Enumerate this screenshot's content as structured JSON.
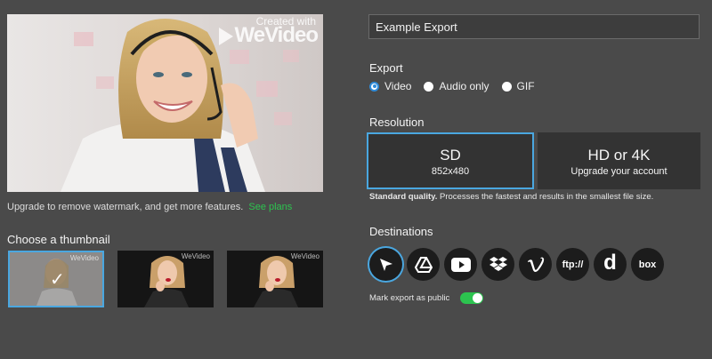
{
  "preview": {
    "watermark_line1": "Created with",
    "watermark_logo": "WeVideo"
  },
  "upgrade": {
    "text": "Upgrade to remove watermark, and get more features.",
    "link": "See plans"
  },
  "thumbnails": {
    "title": "Choose a thumbnail",
    "selected_index": 0,
    "check": "✓",
    "watermark": "WeVideo"
  },
  "export_name": {
    "value": "Example Export"
  },
  "export": {
    "label": "Export",
    "options": [
      "Video",
      "Audio only",
      "GIF"
    ],
    "selected": "Video"
  },
  "resolution": {
    "label": "Resolution",
    "sd": {
      "title": "SD",
      "subtitle": "852x480"
    },
    "hd": {
      "title": "HD or 4K",
      "subtitle": "Upgrade your account"
    },
    "note_bold": "Standard quality.",
    "note": "Processes the fastest and results in the smallest file size."
  },
  "destinations": {
    "label": "Destinations",
    "items": [
      "wevideo-icon",
      "google-drive-icon",
      "youtube-icon",
      "dropbox-icon",
      "vimeo-icon",
      "ftp-icon",
      "dailymotion-icon",
      "box-icon"
    ],
    "ftp_text": "ftp://",
    "dailymotion_text": "d",
    "box_text": "box"
  },
  "public": {
    "label": "Mark export as public",
    "enabled": true
  },
  "colors": {
    "accent_blue": "#4aa7e0",
    "accent_green": "#2cc44f",
    "background": "#4a4a4a"
  }
}
